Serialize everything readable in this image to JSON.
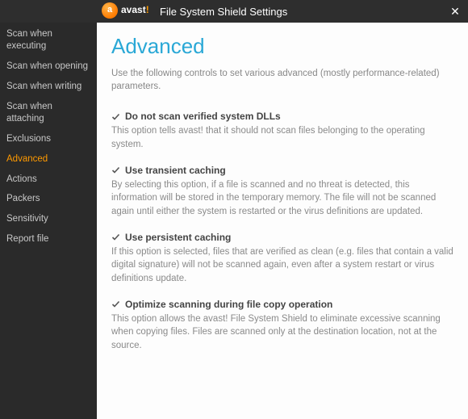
{
  "header": {
    "brand": "avast",
    "title": "File System Shield Settings",
    "close_label": "✕"
  },
  "sidebar": {
    "items": [
      {
        "label": "Scan when executing"
      },
      {
        "label": "Scan when opening"
      },
      {
        "label": "Scan when writing"
      },
      {
        "label": "Scan when attaching"
      },
      {
        "label": "Exclusions"
      },
      {
        "label": "Advanced"
      },
      {
        "label": "Actions"
      },
      {
        "label": "Packers"
      },
      {
        "label": "Sensitivity"
      },
      {
        "label": "Report file"
      }
    ],
    "active_index": 5
  },
  "page": {
    "title": "Advanced",
    "subtitle": "Use the following controls to set various advanced (mostly performance-related) parameters.",
    "options": [
      {
        "checked": true,
        "label": "Do not scan verified system DLLs",
        "description": "This option tells avast! that it should not scan files belonging to the operating system."
      },
      {
        "checked": true,
        "label": "Use transient caching",
        "description": "By selecting this option, if a file is scanned and no threat is detected, this information will be stored in the temporary memory. The file will not be scanned again until either the system is restarted or the virus definitions are updated."
      },
      {
        "checked": true,
        "label": "Use persistent caching",
        "description": "If this option is selected, files that are verified as clean (e.g. files that contain a valid digital signature) will not be scanned again, even after a system restart or virus definitions update."
      },
      {
        "checked": true,
        "label": "Optimize scanning during file copy operation",
        "description": "This option allows the avast! File System Shield to eliminate excessive scanning when copying files. Files are scanned only at the destination location, not at the source."
      }
    ]
  },
  "colors": {
    "accent": "#ff9a00",
    "title": "#2aa8d6",
    "sidebar_bg": "#2a2a2a"
  }
}
